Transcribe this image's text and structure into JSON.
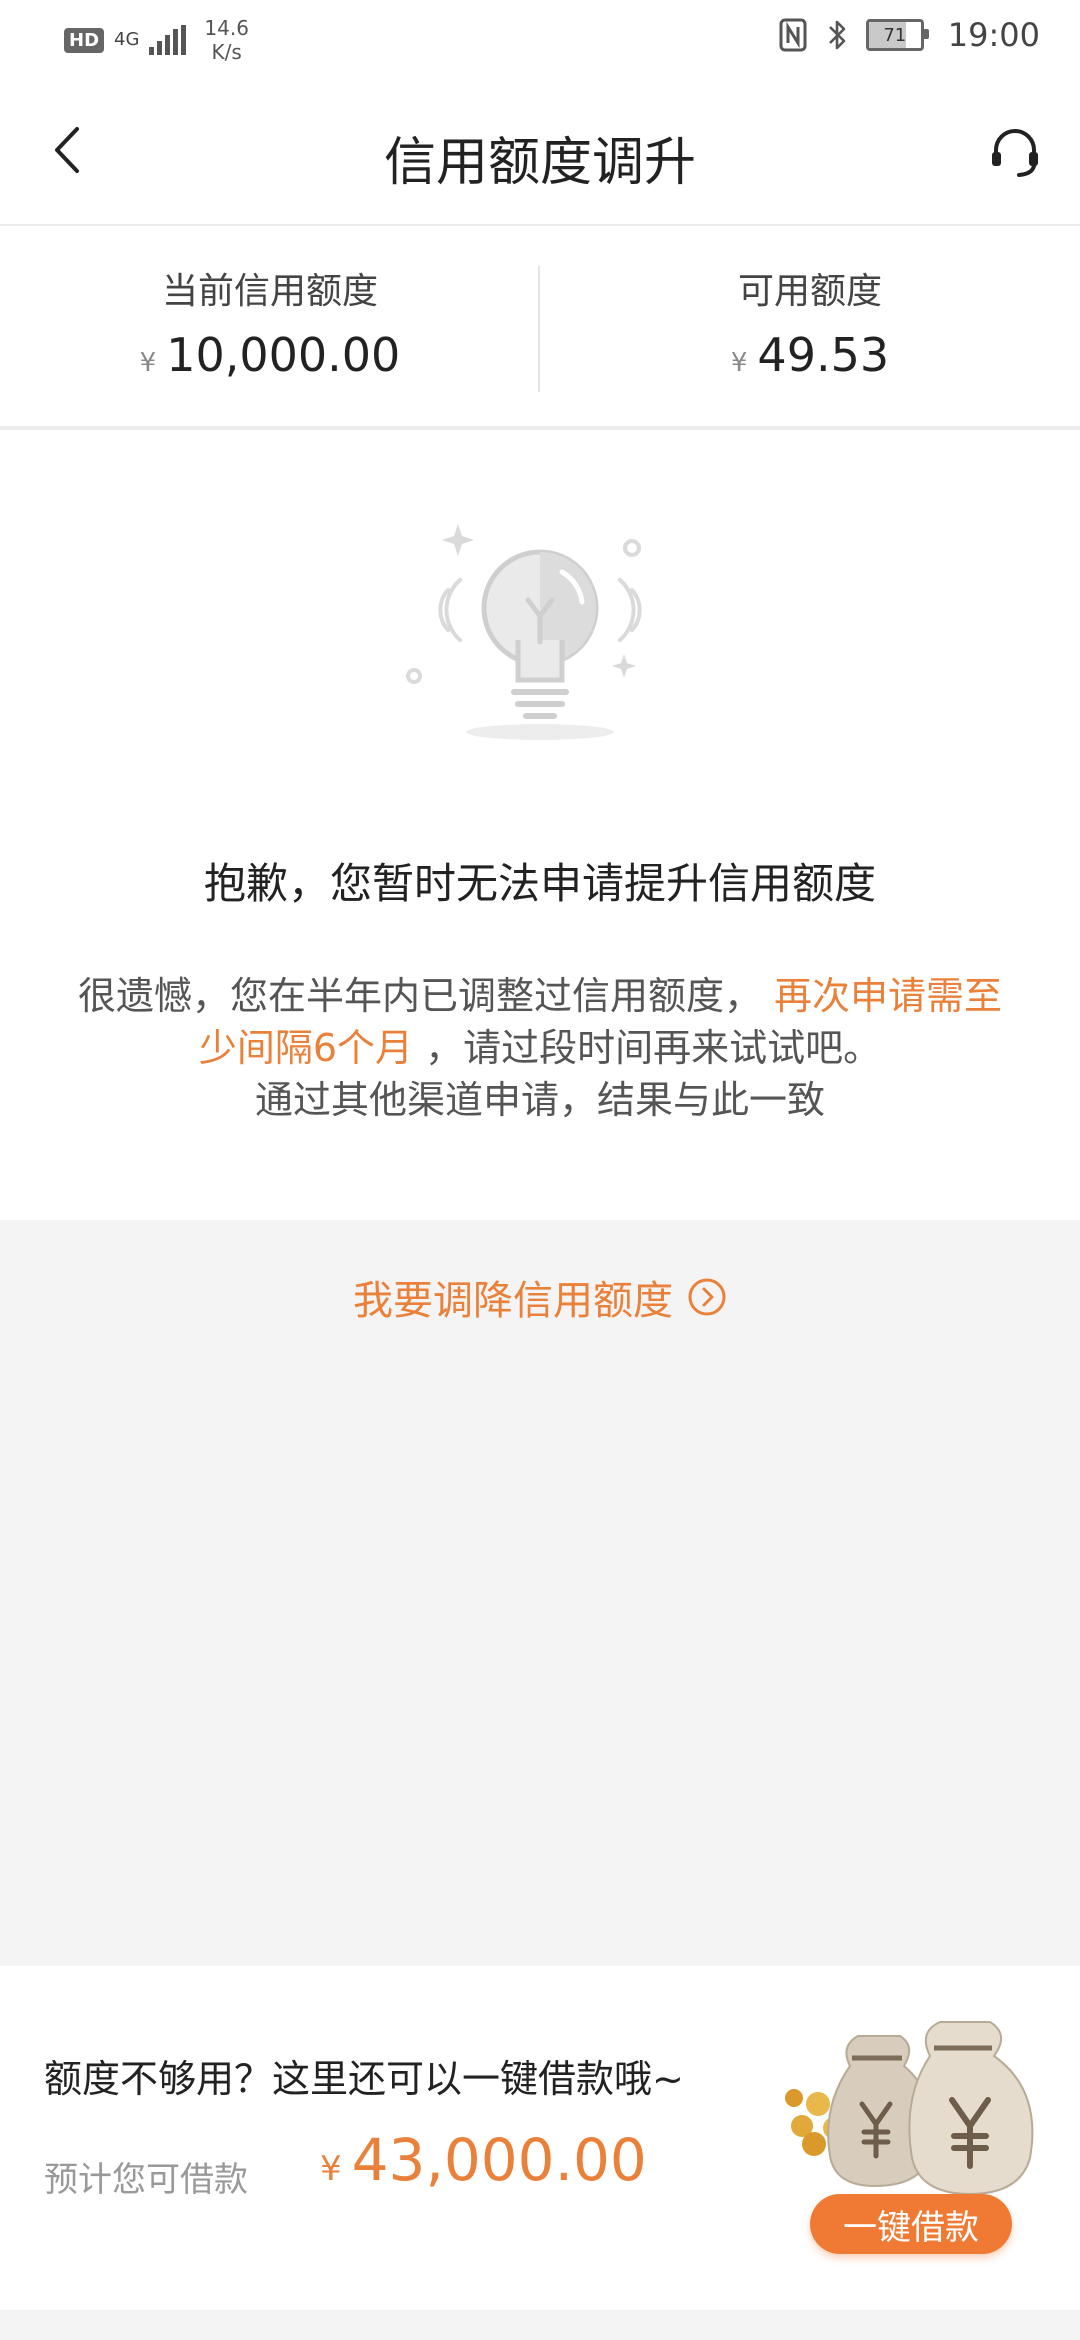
{
  "status_bar": {
    "hd_label": "HD",
    "network_label": "4G",
    "speed_value": "14.6",
    "speed_unit": "K/s",
    "battery_level": "71",
    "time": "19:00"
  },
  "nav": {
    "title": "信用额度调升",
    "back_icon": "chevron-left-icon",
    "support_icon": "headset-icon"
  },
  "quota": {
    "current_label": "当前信用额度",
    "current_currency": "¥",
    "current_amount": "10,000.00",
    "available_label": "可用额度",
    "available_currency": "¥",
    "available_amount": "49.53"
  },
  "notice": {
    "illustration_icon": "lightbulb-icon",
    "title": "抱歉，您暂时无法申请提升信用额度",
    "desc_part1": "很遗憾，您在半年内已调整过信用额度，",
    "desc_highlight": "再次申请需至少间隔6个月",
    "desc_part2": "，请过段时间再来试试吧。",
    "desc_line3": "通过其他渠道申请，结果与此一致"
  },
  "lower_link": {
    "label": "我要调降信用额度",
    "icon": "chevron-right-circle-icon"
  },
  "loan": {
    "tip": "额度不够用？这里还可以一键借款哦~",
    "estimate_label": "预计您可借款",
    "currency": "¥",
    "amount": "43,000.00",
    "button_label": "一键借款",
    "illustration_icon": "money-bags-icon"
  },
  "colors": {
    "accent": "#e9813a",
    "button": "#f07a33",
    "page_bg": "#f4f4f4"
  }
}
